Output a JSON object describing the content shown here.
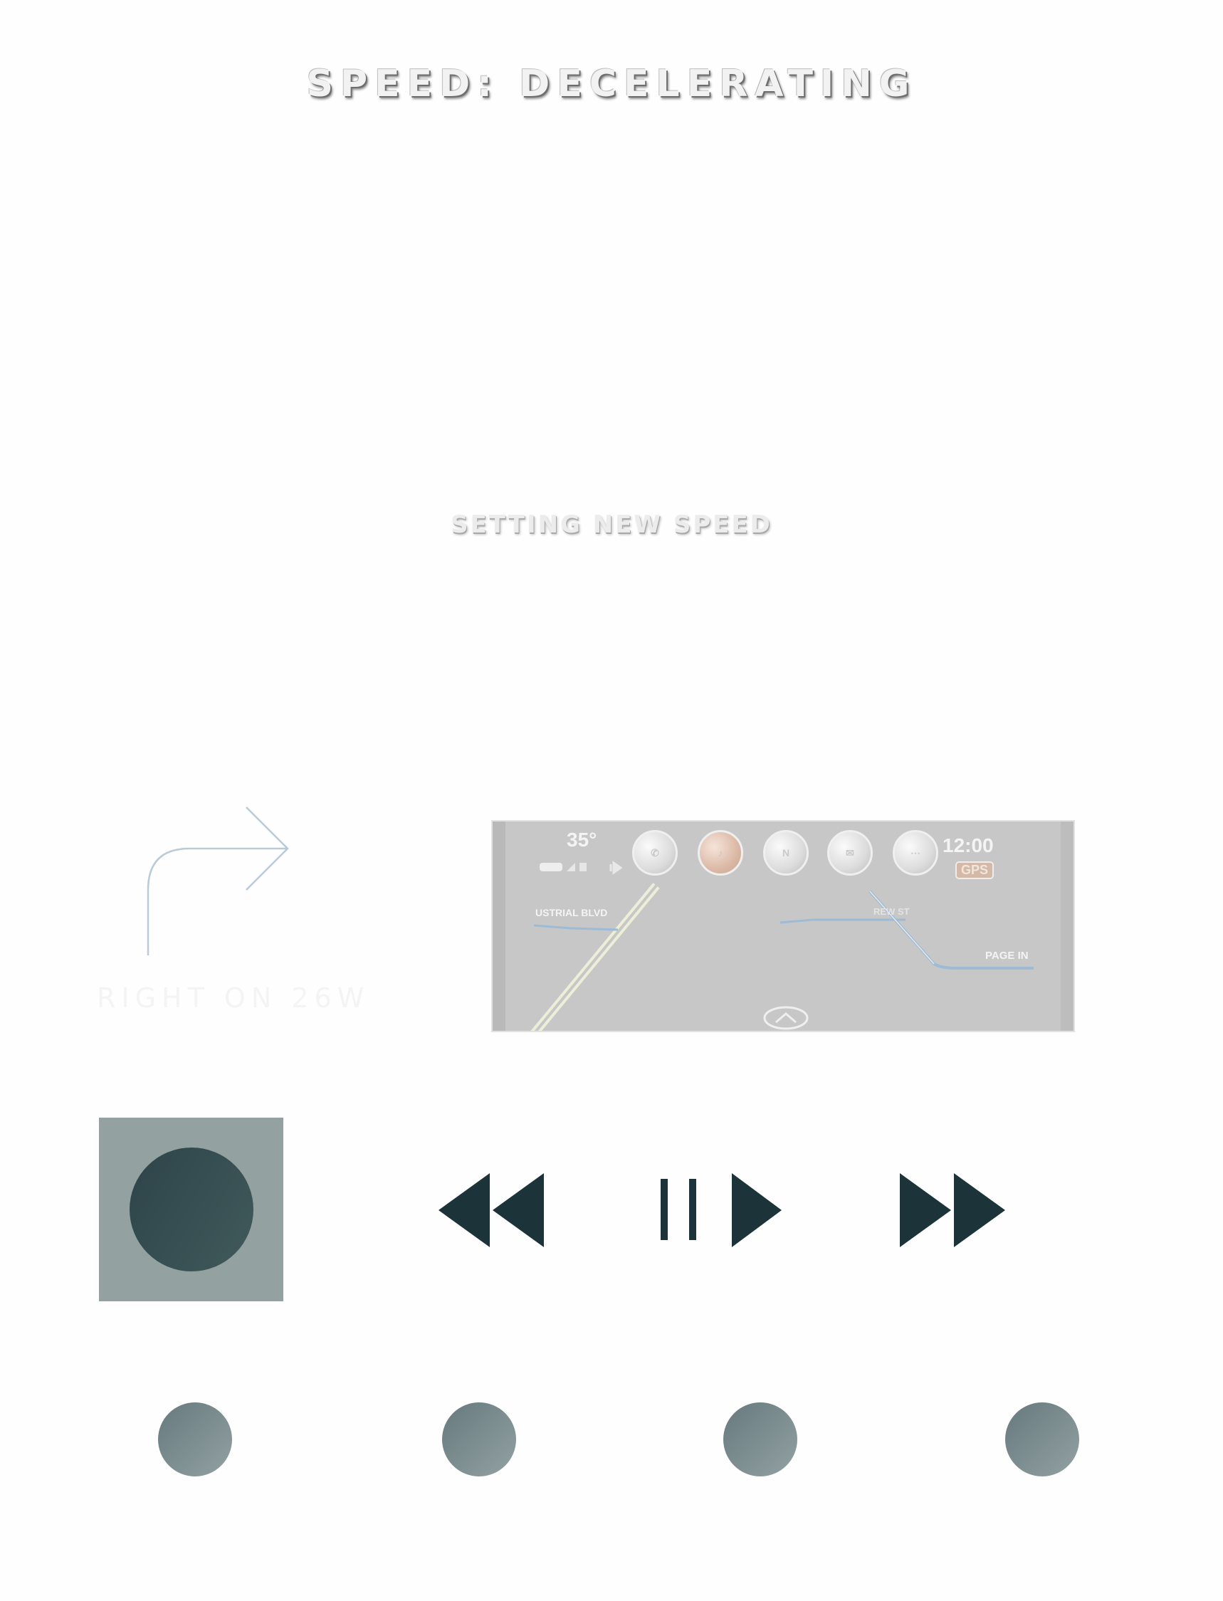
{
  "header": {
    "speed_status": "SPEED: DECELERATING",
    "speed_subtitle": "SETTING NEW SPEED"
  },
  "navigation": {
    "turn_icon": "turn-right-arrow",
    "turn_instruction": "RIGHT ON 26W"
  },
  "dashboard_preview": {
    "temperature": "35°",
    "time": "12:00",
    "gps_badge": "GPS",
    "street_left": "USTRIAL BLVD",
    "street_center": "REW ST",
    "street_right": "PAGE IN",
    "app_icons": [
      "phone",
      "music",
      "n",
      "messages",
      "more"
    ]
  },
  "media_controls": {
    "buttons": [
      "stop",
      "rewind",
      "play-pause",
      "fast-forward"
    ],
    "accent_color": "#1c3439",
    "stop_background": "#93a2a1"
  },
  "pager": {
    "dots": 4
  }
}
